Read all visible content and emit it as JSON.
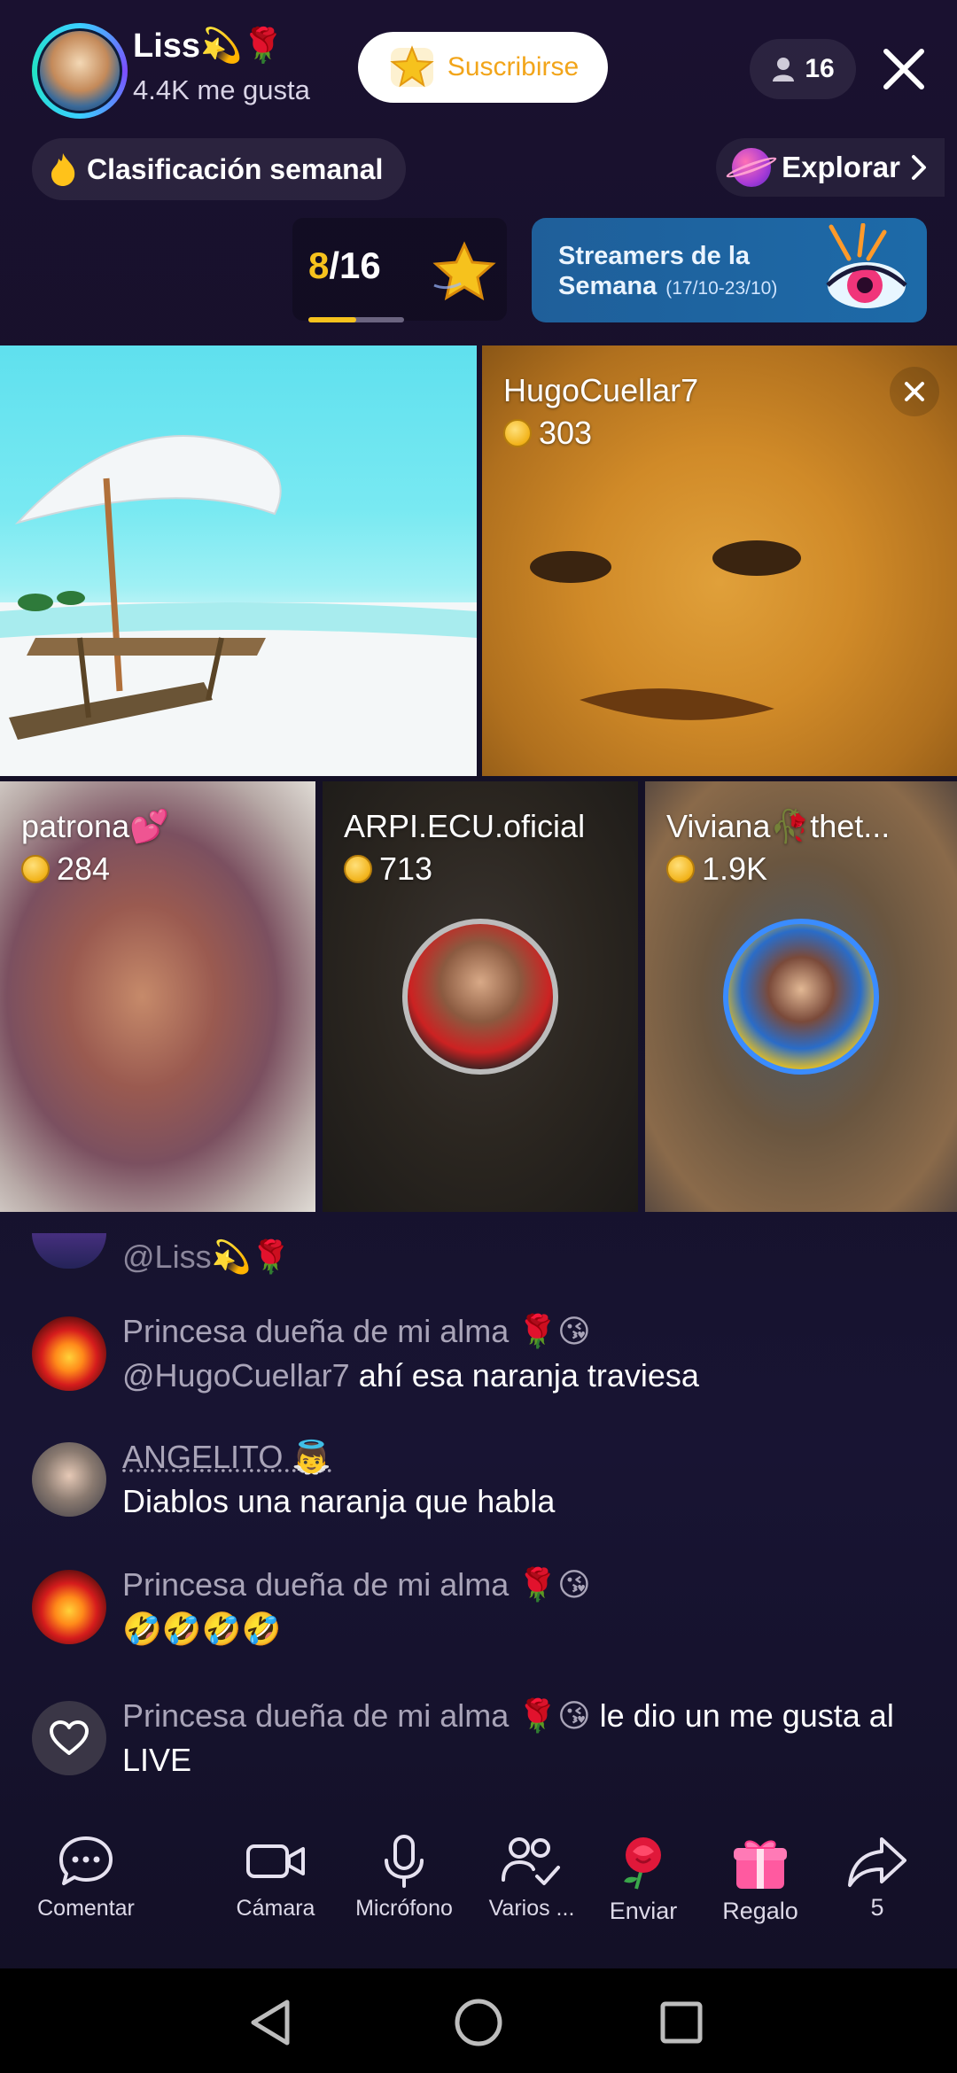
{
  "header": {
    "host_name": "Liss💫🌹",
    "host_likes": "4.4K me gusta",
    "subscribe_label": "Suscribirse",
    "viewer_count": "16",
    "ranking_label": "Clasificación semanal",
    "explore_label": "Explorar",
    "progress_current": "8",
    "progress_total": "/16",
    "progress_fraction": 0.5,
    "banner_title": "Streamers de la Semana",
    "banner_date": "(17/10-23/10)"
  },
  "guests": [
    {
      "name": "HugoCuellar7",
      "coins": "303"
    },
    {
      "name": "patrona💕",
      "coins": "284"
    },
    {
      "name": "ARPI.ECU.oficial",
      "coins": "713"
    },
    {
      "name": "Viviana🥀thet...",
      "coins": "1.9K"
    }
  ],
  "chat": {
    "partial_mention": "@Liss💫🌹",
    "messages": [
      {
        "user": "Princesa dueña de mi alma 🌹😘",
        "mention": "@HugoCuellar7",
        "text": "ahí esa naranja traviesa"
      },
      {
        "user": "ANGELITO 👼",
        "text": "Diablos una naranja que habla"
      },
      {
        "user": "Princesa dueña de mi alma 🌹😘",
        "text": "🤣🤣🤣🤣"
      },
      {
        "user": "Princesa dueña de mi alma 🌹😘",
        "text": "le dio un me gusta al LIVE"
      }
    ]
  },
  "toolbar": {
    "comment": "Comentar",
    "camera": "Cámara",
    "microphone": "Micrófono",
    "multi": "Varios ...",
    "send": "Enviar",
    "gift": "Regalo",
    "share_count": "5"
  },
  "colors": {
    "accent_gold": "#f6c21d",
    "subscribe_text": "#f2a51a",
    "banner_blue": "#1d6aa8"
  },
  "icons": {
    "viewers": "person-icon",
    "close": "close-icon",
    "ranking": "fire-icon",
    "explore": "planet-icon",
    "comment": "chat-bubble-icon",
    "camera": "video-camera-icon",
    "microphone": "microphone-icon",
    "multi": "multi-guest-icon",
    "send": "rose-icon",
    "gift": "gift-icon",
    "share": "share-arrow-icon"
  }
}
